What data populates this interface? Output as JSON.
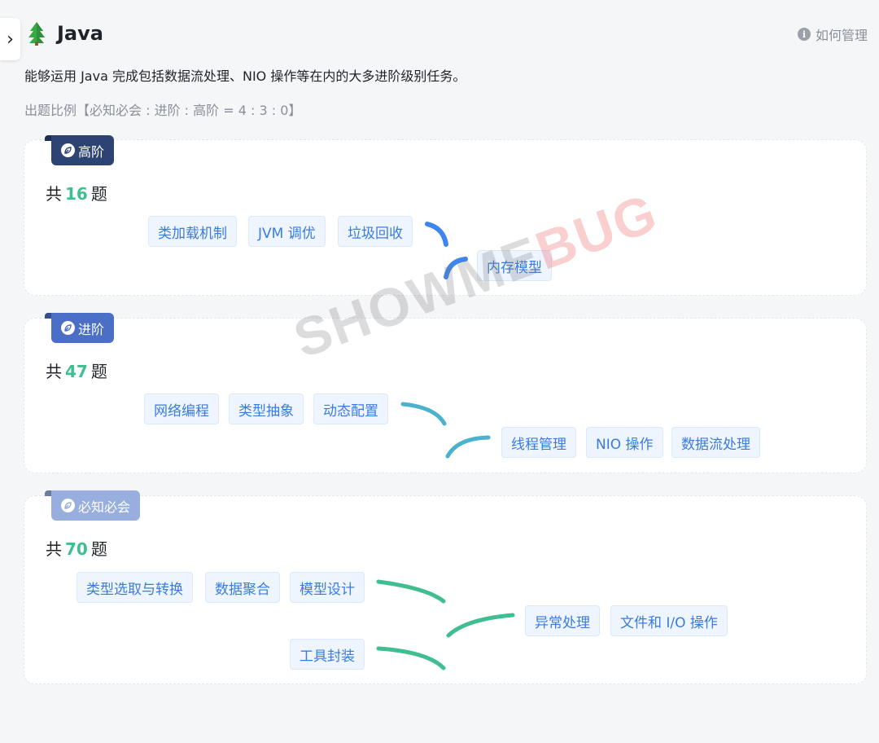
{
  "header": {
    "title": "Java",
    "manage_label": "如何管理",
    "description": "能够运用 Java 完成包括数据流处理、NIO 操作等在内的大多进阶级别任务。",
    "ratio": "出题比例【必知必会 : 进阶 : 高阶 = 4 : 3 : 0】"
  },
  "levels": [
    {
      "badge": "高阶",
      "count_prefix": "共",
      "count": "16",
      "count_suffix": "题",
      "topics": [
        "类加载机制",
        "JVM 调优",
        "垃圾回收",
        "内存模型"
      ]
    },
    {
      "badge": "进阶",
      "count_prefix": "共",
      "count": "47",
      "count_suffix": "题",
      "topics": [
        "网络编程",
        "类型抽象",
        "动态配置",
        "线程管理",
        "NIO 操作",
        "数据流处理"
      ]
    },
    {
      "badge": "必知必会",
      "count_prefix": "共",
      "count": "70",
      "count_suffix": "题",
      "topics": [
        "类型选取与转换",
        "数据聚合",
        "模型设计",
        "异常处理",
        "文件和 I/O 操作",
        "工具封装"
      ]
    }
  ],
  "watermark": {
    "part1": "SHOWME",
    "part2": "BUG"
  },
  "colors": {
    "high": "#2d4374",
    "mid": "#4b6fc7",
    "base": "#98aedf",
    "count_number": "#3fbf8f",
    "chip_text": "#3a7be0"
  },
  "icons": {
    "sidebar_toggle": "chevron-right-icon",
    "title": "tree-icon",
    "manage": "info-icon",
    "badge": "leaf-icon"
  }
}
